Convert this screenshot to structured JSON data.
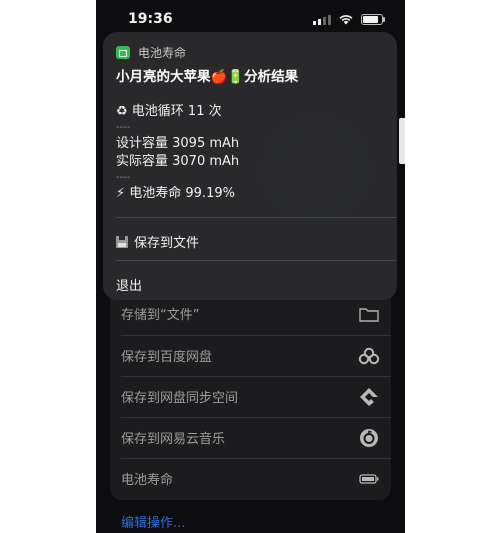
{
  "status_bar": {
    "time": "19:36"
  },
  "card": {
    "app_name": "电池寿命",
    "title": "小月亮的大苹果🍎🔋分析结果",
    "cycle_line": "♻ 电池循环 11 次",
    "dash1": "----",
    "design_capacity": "设计容量 3095 mAh",
    "actual_capacity": "实际容量 3070 mAh",
    "dash2": "----",
    "health_line": "⚡ 电池寿命 99.19%",
    "save_action": "保存到文件",
    "exit_action": "退出"
  },
  "share_sheet": {
    "items": [
      {
        "label": "存储到“文件”",
        "icon": "folder-icon"
      },
      {
        "label": "保存到百度网盘",
        "icon": "baidu-netdisk-icon"
      },
      {
        "label": "保存到网盘同步空间",
        "icon": "sync-space-icon"
      },
      {
        "label": "保存到网易云音乐",
        "icon": "netease-music-icon"
      },
      {
        "label": "电池寿命",
        "icon": "battery-icon"
      }
    ],
    "edit_actions": "编辑操作..."
  }
}
